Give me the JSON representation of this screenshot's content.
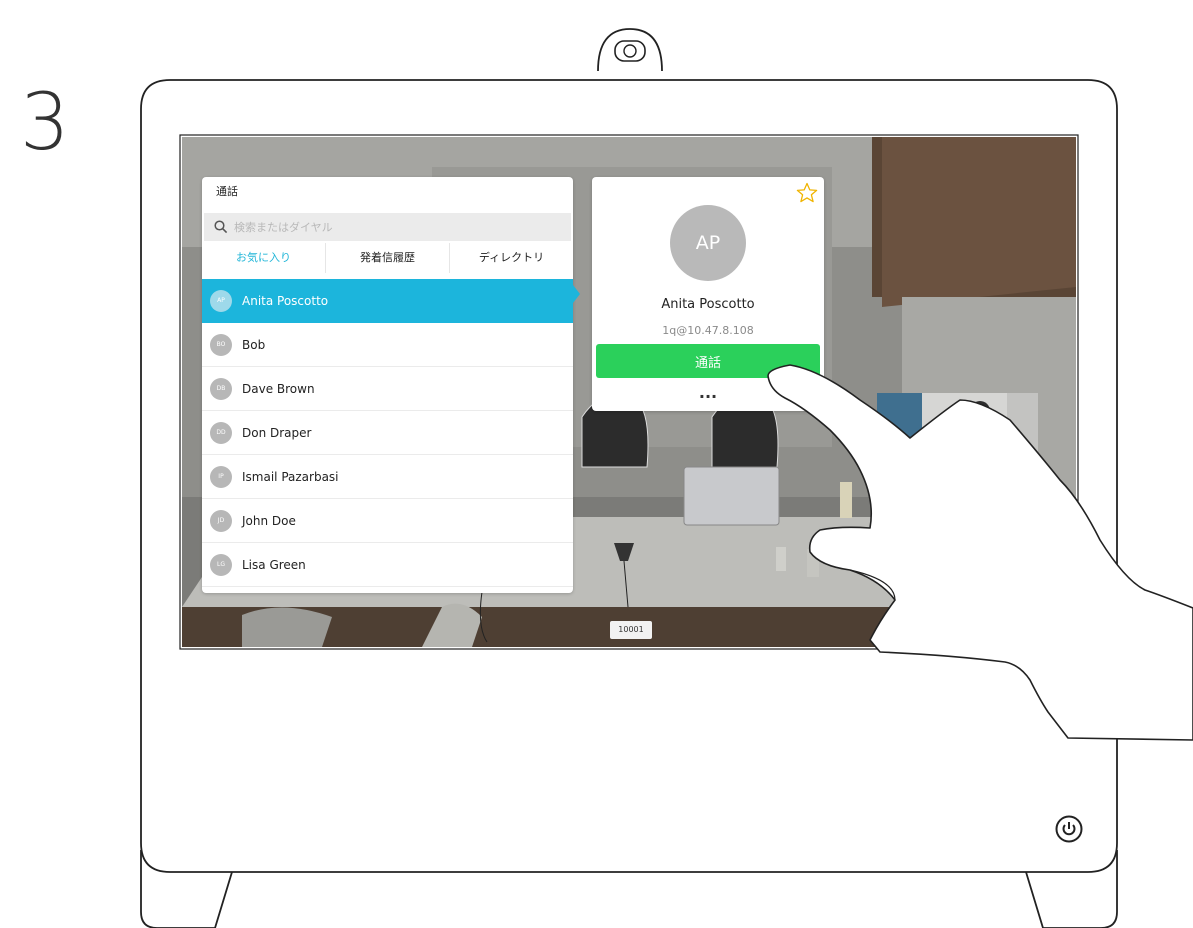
{
  "step": {
    "number": "3"
  },
  "call_panel": {
    "title": "通話",
    "search_placeholder": "検索またはダイヤル",
    "tabs": [
      {
        "label": "お気に入り",
        "active": true
      },
      {
        "label": "発着信履歴",
        "active": false
      },
      {
        "label": "ディレクトリ",
        "active": false
      }
    ],
    "contacts": [
      {
        "initials": "AP",
        "name": "Anita Poscotto",
        "selected": true
      },
      {
        "initials": "BO",
        "name": "Bob",
        "selected": false
      },
      {
        "initials": "DB",
        "name": "Dave Brown",
        "selected": false
      },
      {
        "initials": "DD",
        "name": "Don Draper",
        "selected": false
      },
      {
        "initials": "IP",
        "name": "Ismail Pazarbasi",
        "selected": false
      },
      {
        "initials": "JD",
        "name": "John Doe",
        "selected": false
      },
      {
        "initials": "LG",
        "name": "Lisa Green",
        "selected": false
      }
    ]
  },
  "detail": {
    "initials": "AP",
    "name": "Anita Poscotto",
    "address": "1q@10.47.8.108",
    "call_label": "通話",
    "more_label": "..."
  },
  "video": {
    "number_badge": "10001"
  },
  "colors": {
    "accent": "#1cb5dc",
    "call_green": "#2bd05b",
    "favorite_star": "#f0b400"
  }
}
